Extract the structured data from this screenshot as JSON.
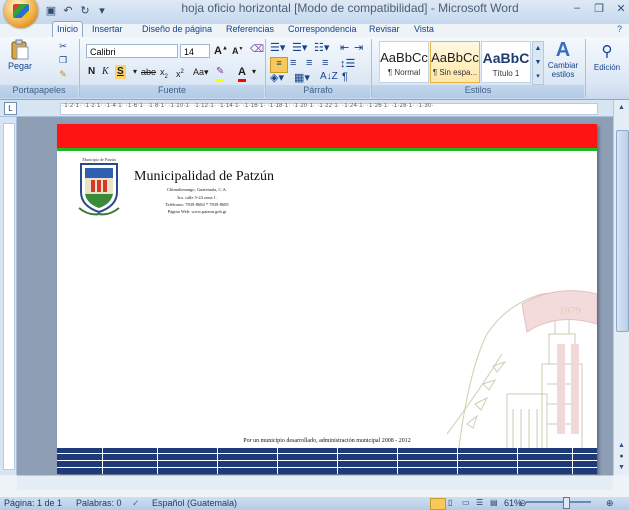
{
  "window": {
    "title": "hoja oficio horizontal [Modo de compatibilidad] - Microsoft Word"
  },
  "tabs": [
    "Inicio",
    "Insertar",
    "Diseño de página",
    "Referencias",
    "Correspondencia",
    "Revisar",
    "Vista"
  ],
  "active_tab": "Inicio",
  "ribbon": {
    "paste_label": "Pegar",
    "font_name": "Calibri",
    "font_size": "14",
    "groups": {
      "clipboard": "Portapapeles",
      "font": "Fuente",
      "paragraph": "Párrafo",
      "styles": "Estilos",
      "editing": "Edición"
    },
    "styles": [
      {
        "sample": "AaBbCc",
        "name": "¶ Normal"
      },
      {
        "sample": "AaBbCc",
        "name": "¶ Sin espa..."
      },
      {
        "sample": "AaBbC",
        "name": "Título 1"
      }
    ],
    "change_styles_label": "Cambiar estilos",
    "editing_label": "Edición"
  },
  "ruler": {
    "ticks": "·1·2·1·  ·1·2·1·  ·1·4·1·  ·1·6·1·  ·1·8·1·  ·1·10·1·  ·1·12·1·  ·1·14·1·  ·1·16·1·  ·1·18·1·  ·1·20·1·  ·1·22·1·  ·1·24·1·  ·1·26·1·  ·1·28·1·  ·1·30·"
  },
  "document": {
    "seal_caption": "Municipio de Patzún",
    "org_name": "Municipalidad de Patzún",
    "address_lines": [
      "Chimaltenango, Guatemala, C.A.",
      "3ra. calle 5-24 zona 1.",
      "Teléfonos: 7839-8684  *  7839-8685",
      "Página Web: www.patzun.gob.gt"
    ],
    "watermark_year": "1979",
    "footer_slogan": "Por un municipio desarrollado, administración municipal 2008 - 2012"
  },
  "status": {
    "page": "Página: 1 de 1",
    "words": "Palabras: 0",
    "language": "Español (Guatemala)",
    "zoom": "61%"
  },
  "colors": {
    "header_red": "#ff1414",
    "header_green": "#1fb91f",
    "footer_navy": "#1e3a78"
  }
}
